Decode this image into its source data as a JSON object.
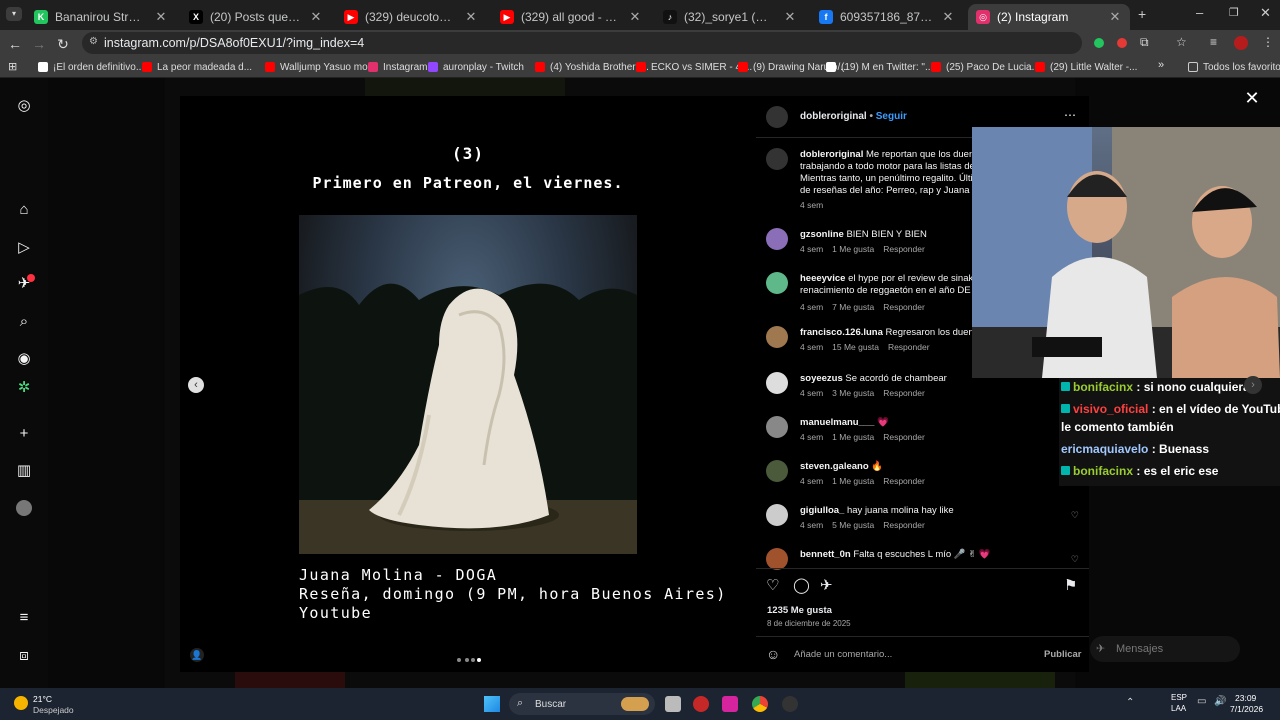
{
  "tabs": [
    {
      "title": "Bananirou Stream - Watch Live",
      "color": "#22c55e",
      "glyph": "K"
    },
    {
      "title": "(20) Posts que Sorye (@Emiluve",
      "color": "#000000",
      "glyph": "X"
    },
    {
      "title": "(329) deucotos - YouTube",
      "color": "#ff0000",
      "glyph": "▶"
    },
    {
      "title": "(329) all good - YouTube",
      "color": "#ff0000",
      "glyph": "▶"
    },
    {
      "title": "(32)_sorye1 (@_sorye1) | TikTok",
      "color": "#111111",
      "glyph": "♪"
    },
    {
      "title": "609357186_874364935314084",
      "color": "#1877f2",
      "glyph": "f"
    },
    {
      "title": "(2) Instagram",
      "color": "#e1306c",
      "glyph": "◎"
    }
  ],
  "address": "instagram.com/p/DSA8of0EXU1/?img_index=4",
  "bookmarks": [
    {
      "label": "¡El orden definitivo...",
      "color": "#ffffff"
    },
    {
      "label": "La peor madeada d...",
      "color": "#ff0000"
    },
    {
      "label": "Walljump Yasuo mo...",
      "color": "#ff0000"
    },
    {
      "label": "Instagram",
      "color": "#e1306c"
    },
    {
      "label": "auronplay - Twitch",
      "color": "#9146ff"
    },
    {
      "label": "(4) Yoshida Brothers...",
      "color": "#ff0000"
    },
    {
      "label": "ECKO vs SIMER - 4t...",
      "color": "#ff0000"
    },
    {
      "label": "(9) Drawing Naruto/...",
      "color": "#ff0000"
    },
    {
      "label": "(19) M en Twitter: \"...",
      "color": "#ffffff"
    },
    {
      "label": "(25) Paco De Lucia...",
      "color": "#ff0000"
    },
    {
      "label": "(29) Little Walter -...",
      "color": "#ff0000"
    }
  ],
  "bookmarks_all": "Todos los favoritos",
  "post": {
    "line1": "(3)",
    "line2": "Primero en Patreon, el viernes.",
    "cap1": "Juana Molina - DOGA",
    "cap2": "Reseña, domingo (9 PM, hora Buenos Aires)",
    "cap3": "Youtube"
  },
  "panel": {
    "username": "dobleroriginal",
    "follow": "Seguir",
    "likes": "1235 Me gusta",
    "date": "8 de diciembre de 2025",
    "comment_placeholder": "Añade un comentario...",
    "publish": "Publicar"
  },
  "comments": [
    {
      "user": "dobleroriginal",
      "text": "Me reportan que los duendes están trabajando a todo motor para las listas de fin de año. Mientras tanto, un penúltimo regalito. Última semana de reseñas del año: Perreo, rap y Juana Molina. Sigan sintonizados.",
      "time": "4 sem",
      "likes": "",
      "reply": "",
      "avatar": "#333333"
    },
    {
      "user": "gzsonline",
      "text": "BIEN BIEN Y BIEN",
      "time": "4 sem",
      "likes": "1 Me gusta",
      "reply": "Responder",
      "avatar": "#8a6fb8"
    },
    {
      "user": "heeeyvice",
      "text": "el hype por el review de sinaka y dalex: el renacimiento de reggaetón en el año DE LEJOS",
      "time": "4 sem",
      "likes": "7 Me gusta",
      "reply": "Responder",
      "avatar": "#5fb88a"
    },
    {
      "user": "francisco.126.luna",
      "text": "Regresaron los duendes",
      "time": "4 sem",
      "likes": "15 Me gusta",
      "reply": "Responder",
      "avatar": "#a07850"
    },
    {
      "user": "soyeezus",
      "text": "Se acordó de chambear",
      "time": "4 sem",
      "likes": "3 Me gusta",
      "reply": "Responder",
      "avatar": "#dddddd"
    },
    {
      "user": "manuelmanu___",
      "text": "💗",
      "time": "4 sem",
      "likes": "1 Me gusta",
      "reply": "Responder",
      "avatar": "#888888"
    },
    {
      "user": "steven.galeano",
      "text": "🔥",
      "time": "4 sem",
      "likes": "1 Me gusta",
      "reply": "Responder",
      "avatar": "#4a5a3a"
    },
    {
      "user": "gigiulloa_",
      "text": "hay juana molina hay like",
      "time": "4 sem",
      "likes": "5 Me gusta",
      "reply": "Responder",
      "avatar": "#cccccc"
    },
    {
      "user": "bennett_0n",
      "text": "Falta q escuches L mío 🎤 ✌ 💗",
      "time": "4 sem",
      "likes": "",
      "reply": "",
      "avatar": "#a0522d"
    }
  ],
  "chat": [
    {
      "user": "bonifacinx",
      "msg": "si nono cualquiera",
      "color": "#9acd32",
      "badge": true
    },
    {
      "user": "visivo_oficial",
      "msg": "en el vídeo de YouTube",
      "color": "#ff4040",
      "badge": true
    },
    {
      "user": "",
      "msg": "le comento también",
      "color": "#ffffff",
      "badge": false
    },
    {
      "user": "ericmaquiavelo",
      "msg": "Buenass",
      "color": "#a0c8ff",
      "badge": false
    },
    {
      "user": "bonifacinx",
      "msg": "es el eric ese",
      "color": "#9acd32",
      "badge": true
    }
  ],
  "mensajes": "Mensajes",
  "taskbar": {
    "temp": "21°C",
    "weather": "Despejado",
    "search": "Buscar",
    "lang1": "ESP",
    "lang2": "LAA",
    "time": "23:09",
    "date": "7/1/2026"
  }
}
